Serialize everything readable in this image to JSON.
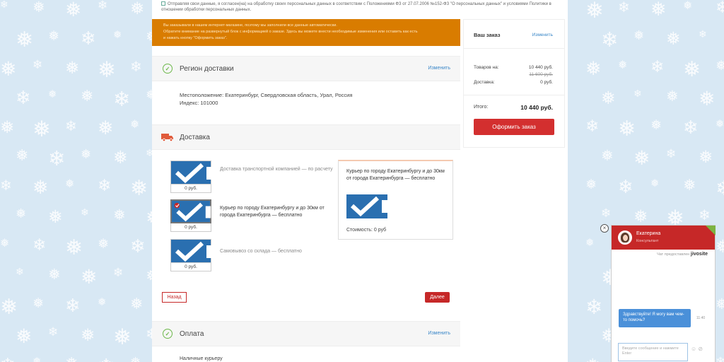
{
  "consent": {
    "text": "Отправляя свои данные, я согласен(на) на обработку своих персональных данных в соответствии с Положениями ФЗ от 27.07.2006 №152-ФЗ \"О персональных данных\" и условиями Политики в отношении обработки персональных данных."
  },
  "warning": {
    "line1": "Вы заказывали в нашем интернет-магазине, поэтому мы заполнили все данные автоматически.",
    "line2": "Обратите внимание на развернутый блок с информацией о заказе. Здесь вы можете внести необходимые изменения или оставить как есть",
    "line3": "и нажать кнопку \"Оформить заказ\"."
  },
  "region": {
    "title": "Регион доставки",
    "edit_label": "Изменить",
    "location": "Местоположение: Екатеринбург, Свердловская область, Урал, Россия",
    "index": "Индекс: 101000"
  },
  "delivery": {
    "title": "Доставка",
    "options": [
      {
        "label": "Доставка транспортной компанией — по расчету",
        "price": "0 руб."
      },
      {
        "label": "Курьер по городу Екатеринбургу и до 30км от города Екатеринбурга — бесплатно",
        "price": "0 руб."
      },
      {
        "label": "Самовывоз со склада — бесплатно",
        "price": "0 руб."
      }
    ],
    "selected_detail": {
      "title": "Курьер по городу Екатеринбургу и до 30км от города Екатеринбурга — бесплатно",
      "cost": "Стоимость: 0 руб"
    },
    "back_label": "Назад",
    "next_label": "Далее"
  },
  "payment": {
    "title": "Оплата",
    "edit_label": "Изменить",
    "first_option": "Наличные курьеру"
  },
  "order": {
    "title": "Ваш заказ",
    "edit_label": "Изменить",
    "goods_label": "Товаров на:",
    "goods_value": "10 440 руб.",
    "goods_old_value": "11 600 руб.",
    "delivery_label": "Доставка:",
    "delivery_value": "0 руб.",
    "total_label": "Итого:",
    "total_value": "10 440 руб.",
    "submit_label": "Оформить заказ"
  },
  "chat": {
    "agent_name": "Екатерина",
    "agent_role": "Консультант",
    "powered_prefix": "Чат предоставлен",
    "powered_brand": "jivosite",
    "message": "Здравствуйте! Я могу вам чем-то помочь?",
    "time": "11:40",
    "input_placeholder": "Введите сообщение и нажмите Enter"
  },
  "colors": {
    "accent_red": "#c62828",
    "warning_orange": "#d97c00",
    "link_blue": "#3a87c8",
    "success_green": "#6cb84a"
  }
}
